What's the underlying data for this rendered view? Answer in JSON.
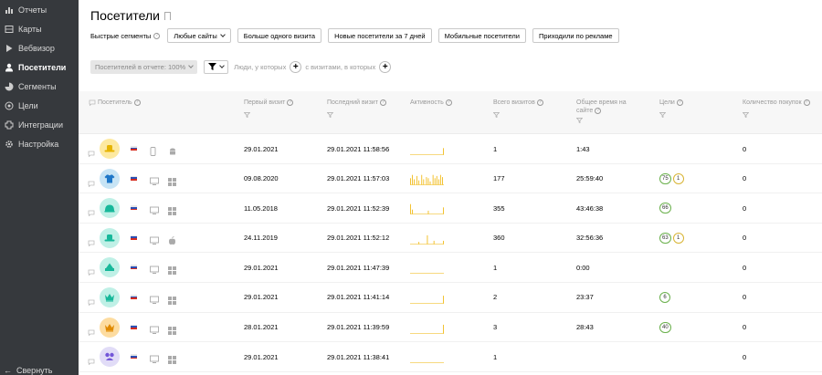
{
  "sidebar": {
    "items": [
      {
        "label": "Отчеты",
        "icon": "bar-chart-icon",
        "active": false
      },
      {
        "label": "Карты",
        "icon": "map-icon",
        "active": false
      },
      {
        "label": "Вебвизор",
        "icon": "play-icon",
        "active": false
      },
      {
        "label": "Посетители",
        "icon": "person-icon",
        "active": true
      },
      {
        "label": "Сегменты",
        "icon": "segments-icon",
        "active": false
      },
      {
        "label": "Цели",
        "icon": "target-icon",
        "active": false
      },
      {
        "label": "Интеграции",
        "icon": "integrations-icon",
        "active": false
      },
      {
        "label": "Настройка",
        "icon": "gear-icon",
        "active": false
      }
    ],
    "collapse_label": "Свернуть"
  },
  "header": {
    "title": "Посетители"
  },
  "quick_segments": {
    "label": "Быстрые сегменты",
    "dropdown": "Любые сайты",
    "buttons": [
      "Больше одного визита",
      "Новые посетители за 7 дней",
      "Мобильные посетители",
      "Приходили по рекламе"
    ]
  },
  "filters": {
    "share": "Посетителей в отчете: 100%",
    "people_text": "Люди, у которых",
    "visits_text": "с визитами, в которых"
  },
  "table": {
    "columns": {
      "visitor": "Посетитель",
      "first_visit": "Первый визит",
      "last_visit": "Последний визит",
      "activity": "Активность",
      "total_visits": "Всего визитов",
      "total_time_1": "Общее время на",
      "total_time_2": "сайте",
      "goals": "Цели",
      "purchases": "Количество покупок"
    },
    "rows": [
      {
        "first": "29.01.2021",
        "last": "29.01.2021 11:58:56",
        "visits": "1",
        "time": "1:43",
        "goals": [],
        "purchases": "0",
        "avatar": "hat-icon",
        "avatar_bg": "#fde9a0",
        "avatar_fg": "#e6b400",
        "device": "mobile-icon",
        "os": "android-icon",
        "spark": [
          0,
          0,
          0,
          0,
          0,
          0,
          0,
          0,
          0,
          0,
          0,
          0,
          0,
          0,
          0,
          0,
          0,
          0,
          0,
          0,
          0,
          0,
          0,
          0,
          0,
          0,
          0,
          0,
          0,
          0,
          0,
          0,
          0,
          0,
          0,
          0.6
        ]
      },
      {
        "first": "09.08.2020",
        "last": "29.01.2021 11:57:03",
        "visits": "177",
        "time": "25:59:40",
        "goals": [
          {
            "v": "75",
            "c": "green"
          },
          {
            "v": "1",
            "c": "yellow"
          }
        ],
        "purchases": "0",
        "avatar": "tshirt-icon",
        "avatar_bg": "#c7e4f5",
        "avatar_fg": "#1e77c8",
        "device": "desktop-icon",
        "os": "windows-icon",
        "spark": [
          0.6,
          0,
          0.9,
          0,
          0.5,
          0,
          0,
          0.8,
          0,
          0.4,
          0,
          0,
          0.9,
          0,
          0.5,
          0,
          0,
          0.7,
          0,
          0.6,
          0,
          0.3,
          0,
          0,
          0.9,
          0,
          0.6,
          0,
          0.8,
          0,
          0.5,
          0,
          0.9,
          0,
          0.7,
          0
        ]
      },
      {
        "first": "11.05.2018",
        "last": "29.01.2021 11:52:39",
        "visits": "355",
        "time": "43:46:38",
        "goals": [
          {
            "v": "66",
            "c": "green"
          }
        ],
        "purchases": "0",
        "avatar": "dome-icon",
        "avatar_bg": "#bff0e6",
        "avatar_fg": "#17b89a",
        "device": "desktop-icon",
        "os": "windows-icon",
        "spark": [
          0.9,
          0,
          0.4,
          0,
          0,
          0,
          0,
          0,
          0,
          0,
          0,
          0,
          0,
          0,
          0,
          0,
          0,
          0,
          0,
          0.3,
          0,
          0,
          0,
          0,
          0,
          0,
          0,
          0,
          0,
          0,
          0,
          0,
          0,
          0,
          0,
          0.6
        ]
      },
      {
        "first": "24.11.2019",
        "last": "29.01.2021 11:52:12",
        "visits": "360",
        "time": "32:56:36",
        "goals": [
          {
            "v": "63",
            "c": "green"
          },
          {
            "v": "1",
            "c": "yellow"
          }
        ],
        "purchases": "0",
        "avatar": "hat-icon",
        "avatar_bg": "#bff0e6",
        "avatar_fg": "#17b89a",
        "device": "desktop-icon",
        "os": "apple-icon",
        "spark": [
          0,
          0,
          0,
          0,
          0,
          0,
          0,
          0,
          0,
          0.2,
          0,
          0,
          0,
          0,
          0,
          0,
          0,
          0,
          0.8,
          0,
          0,
          0,
          0,
          0,
          0,
          0.3,
          0,
          0,
          0,
          0,
          0,
          0,
          0,
          0,
          0,
          0.3
        ]
      },
      {
        "first": "29.01.2021",
        "last": "29.01.2021 11:47:39",
        "visits": "1",
        "time": "0:00",
        "goals": [],
        "purchases": "0",
        "avatar": "cake-icon",
        "avatar_bg": "#bff0e6",
        "avatar_fg": "#17b89a",
        "device": "desktop-icon",
        "os": "windows-icon",
        "spark": []
      },
      {
        "first": "29.01.2021",
        "last": "29.01.2021 11:41:14",
        "visits": "2",
        "time": "23:37",
        "goals": [
          {
            "v": "6",
            "c": "green"
          }
        ],
        "purchases": "0",
        "avatar": "crown-icon",
        "avatar_bg": "#bff0e6",
        "avatar_fg": "#17b89a",
        "device": "desktop-icon",
        "os": "windows-icon",
        "spark": [
          0,
          0,
          0,
          0,
          0,
          0,
          0,
          0,
          0,
          0,
          0,
          0,
          0,
          0,
          0,
          0,
          0,
          0,
          0,
          0,
          0,
          0,
          0,
          0,
          0,
          0,
          0,
          0,
          0,
          0,
          0,
          0,
          0,
          0,
          0,
          0.7
        ]
      },
      {
        "first": "28.01.2021",
        "last": "29.01.2021 11:39:59",
        "visits": "3",
        "time": "28:43",
        "goals": [
          {
            "v": "40",
            "c": "green"
          }
        ],
        "purchases": "0",
        "avatar": "crown-icon",
        "avatar_bg": "#fddca0",
        "avatar_fg": "#e08a00",
        "device": "desktop-icon",
        "os": "windows-icon",
        "spark": [
          0,
          0,
          0,
          0,
          0,
          0,
          0,
          0,
          0,
          0,
          0,
          0,
          0,
          0,
          0,
          0,
          0,
          0,
          0,
          0,
          0,
          0,
          0,
          0,
          0,
          0,
          0,
          0,
          0,
          0,
          0,
          0,
          0,
          0,
          0,
          0.8
        ]
      },
      {
        "first": "29.01.2021",
        "last": "29.01.2021 11:38:41",
        "visits": "1",
        "time": "",
        "goals": [],
        "purchases": "0",
        "avatar": "bow-icon",
        "avatar_bg": "#e1dcf7",
        "avatar_fg": "#7356d8",
        "device": "desktop-icon",
        "os": "windows-icon",
        "spark": []
      }
    ]
  },
  "colors": {
    "sidebar_bg": "#36393d",
    "spark": "#f0b400",
    "goal_green": "#6ab04c",
    "goal_yellow": "#d8b434"
  }
}
